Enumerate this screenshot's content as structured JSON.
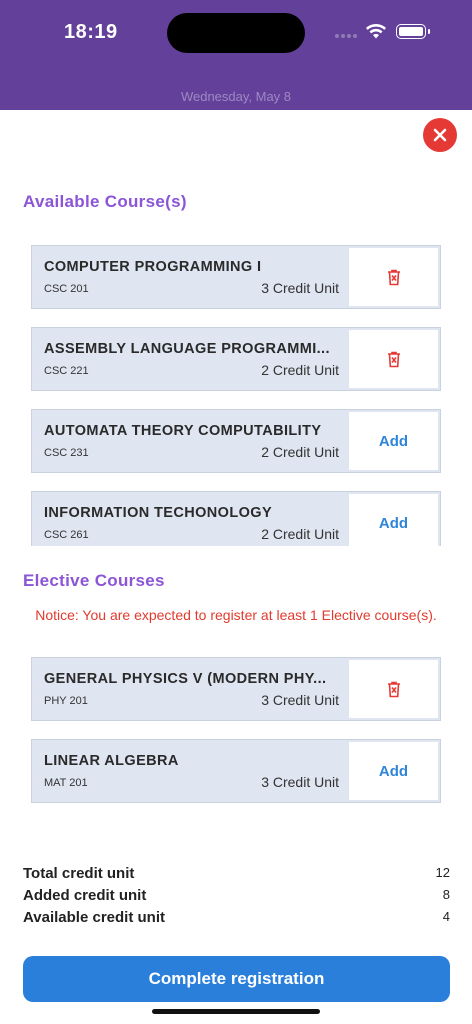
{
  "status": {
    "time": "18:19",
    "date": "Wednesday, May 8"
  },
  "available": {
    "title": "Available Course(s)",
    "courses": [
      {
        "name": "COMPUTER PROGRAMMING I",
        "code": "CSC 201",
        "credit": "3 Credit Unit",
        "action": "delete"
      },
      {
        "name": "ASSEMBLY LANGUAGE PROGRAMMI...",
        "code": "CSC 221",
        "credit": "2 Credit Unit",
        "action": "delete"
      },
      {
        "name": "AUTOMATA THEORY COMPUTABILITY",
        "code": "CSC 231",
        "credit": "2 Credit Unit",
        "action": "Add"
      },
      {
        "name": "INFORMATION TECHONOLOGY",
        "code": "CSC 261",
        "credit": "2 Credit Unit",
        "action": "Add"
      }
    ]
  },
  "elective": {
    "title": "Elective Courses",
    "notice": "Notice: You are expected to register at least 1 Elective course(s).",
    "courses": [
      {
        "name": "GENERAL PHYSICS V (MODERN PHY...",
        "code": "PHY 201",
        "credit": "3 Credit Unit",
        "action": "delete"
      },
      {
        "name": "LINEAR ALGEBRA",
        "code": "MAT 201",
        "credit": "3 Credit Unit",
        "action": "Add"
      }
    ]
  },
  "summary": {
    "total_label": "Total credit unit",
    "total_value": "12",
    "added_label": "Added credit unit",
    "added_value": "8",
    "available_label": "Available credit unit",
    "available_value": "4"
  },
  "complete_label": "Complete registration",
  "colors": {
    "header": "#63409a",
    "accent": "#8b55d6",
    "danger": "#e53935",
    "primary": "#2a7fdb"
  }
}
